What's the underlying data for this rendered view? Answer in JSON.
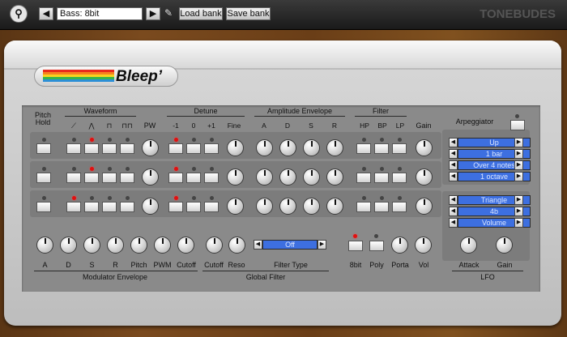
{
  "toolbar": {
    "menu_icon": "bank-menu-icon",
    "prev": "◀",
    "next": "▶",
    "preset_value": "Bass: 8bit",
    "edit_icon": "pencil-icon",
    "load": "Load bank",
    "save": "Save bank",
    "brand": "TONEBUDES"
  },
  "badge": {
    "name": "Bleep’",
    "rainbow": [
      "#e82a1c",
      "#f6821e",
      "#f7d31f",
      "#36b54a",
      "#2c8fd6"
    ]
  },
  "headers": {
    "pitch_hold": "Pitch\nHold",
    "waveform": "Waveform",
    "pw": "PW",
    "detune": "Detune",
    "amp_env": "Amplitude Envelope",
    "filter": "Filter",
    "gain": "Gain",
    "arpeggiator": "Arpeggiator"
  },
  "wave_icons": [
    "⟋",
    "⋀",
    "⊓",
    "⊓⊓"
  ],
  "detune_labels": [
    "-1",
    "0",
    "+1",
    "Fine"
  ],
  "env_labels": [
    "A",
    "D",
    "S",
    "R"
  ],
  "filter_labels": [
    "HP",
    "BP",
    "LP"
  ],
  "rows": [
    {
      "wave_on": 1,
      "detune_on": 0
    },
    {
      "wave_on": 1,
      "detune_on": 0
    },
    {
      "wave_on": 0,
      "detune_on": 0
    }
  ],
  "arp": {
    "mode": "Up",
    "length": "1 bar",
    "steps": "Over 4 notes",
    "range": "1 octave"
  },
  "lfo": {
    "shape": "Triangle",
    "rate": "4b",
    "target": "Volume",
    "attack": "Attack",
    "gain": "Gain",
    "title": "LFO"
  },
  "mod_env": {
    "labels": [
      "A",
      "D",
      "S",
      "R",
      "Pitch",
      "PWM",
      "Cutoff"
    ],
    "title": "Modulator Envelope"
  },
  "global_filter": {
    "cutoff": "Cutoff",
    "reso": "Reso",
    "type_value": "Off",
    "type_label": "Filter Type",
    "title": "Global Filter"
  },
  "misc": {
    "bit8": "8bit",
    "poly": "Poly",
    "porta": "Porta",
    "vol": "Vol"
  }
}
